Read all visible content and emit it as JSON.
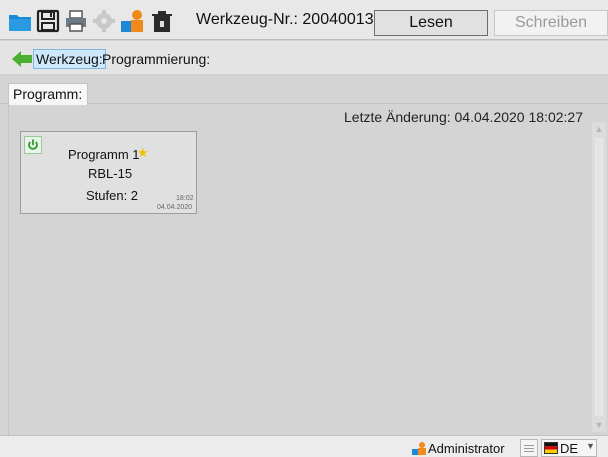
{
  "toolbar": {
    "tool_number": "Werkzeug-Nr.: 20040013",
    "read_label": "Lesen",
    "write_label": "Schreiben",
    "icons": [
      "folder-icon",
      "save-icon",
      "print-icon",
      "settings-icon",
      "user-icon",
      "trash-icon"
    ]
  },
  "breadcrumb": {
    "link_label": "Werkzeug:",
    "current_label": "Programmierung:"
  },
  "tabs": [
    {
      "label": "Programm:"
    }
  ],
  "main": {
    "last_change": "Letzte Änderung:  04.04.2020  18:02:27"
  },
  "program_card": {
    "title": "Programm 1",
    "tool": "RBL-15",
    "steps": "Stufen: 2",
    "time": "18:02",
    "date": "04.04.2020",
    "favorite": true
  },
  "statusbar": {
    "user": "Administrator",
    "language": "DE"
  },
  "colors": {
    "accent_blue": "#1e88d2",
    "power_green": "#2e9a2e",
    "star_yellow": "#f2c200",
    "back_arrow_green": "#4caf32"
  }
}
